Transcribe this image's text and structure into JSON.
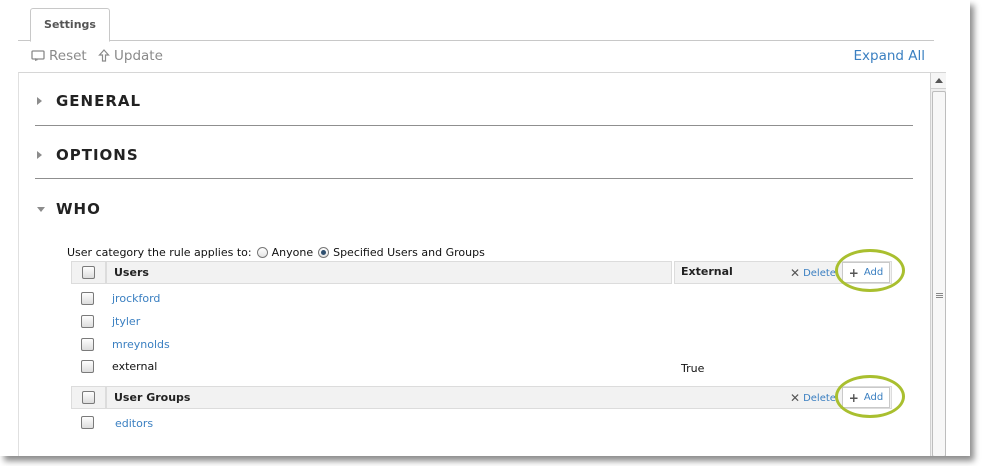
{
  "tabs": {
    "settings": "Settings"
  },
  "toolbar": {
    "reset": "Reset",
    "update": "Update",
    "expand_all": "Expand All"
  },
  "sections": {
    "general": "GENERAL",
    "options": "OPTIONS",
    "who": "WHO"
  },
  "who": {
    "applies_label": "User category the rule applies to:",
    "option_anyone": "Anyone",
    "option_specified": "Specified Users and Groups",
    "selected_option": "Specified Users and Groups",
    "users_table": {
      "header_users": "Users",
      "header_external": "External",
      "delete": "Delete",
      "add": "Add",
      "rows": [
        {
          "name": "jrockford",
          "external": ""
        },
        {
          "name": "jtyler",
          "external": ""
        },
        {
          "name": "mreynolds",
          "external": ""
        },
        {
          "name": "external",
          "external": "True"
        }
      ]
    },
    "groups_table": {
      "header_groups": "User Groups",
      "delete": "Delete",
      "add": "Add",
      "rows": [
        {
          "name": "editors"
        }
      ]
    }
  },
  "colors": {
    "link": "#3a7fc1",
    "highlight_ring": "#a9bf2f"
  }
}
